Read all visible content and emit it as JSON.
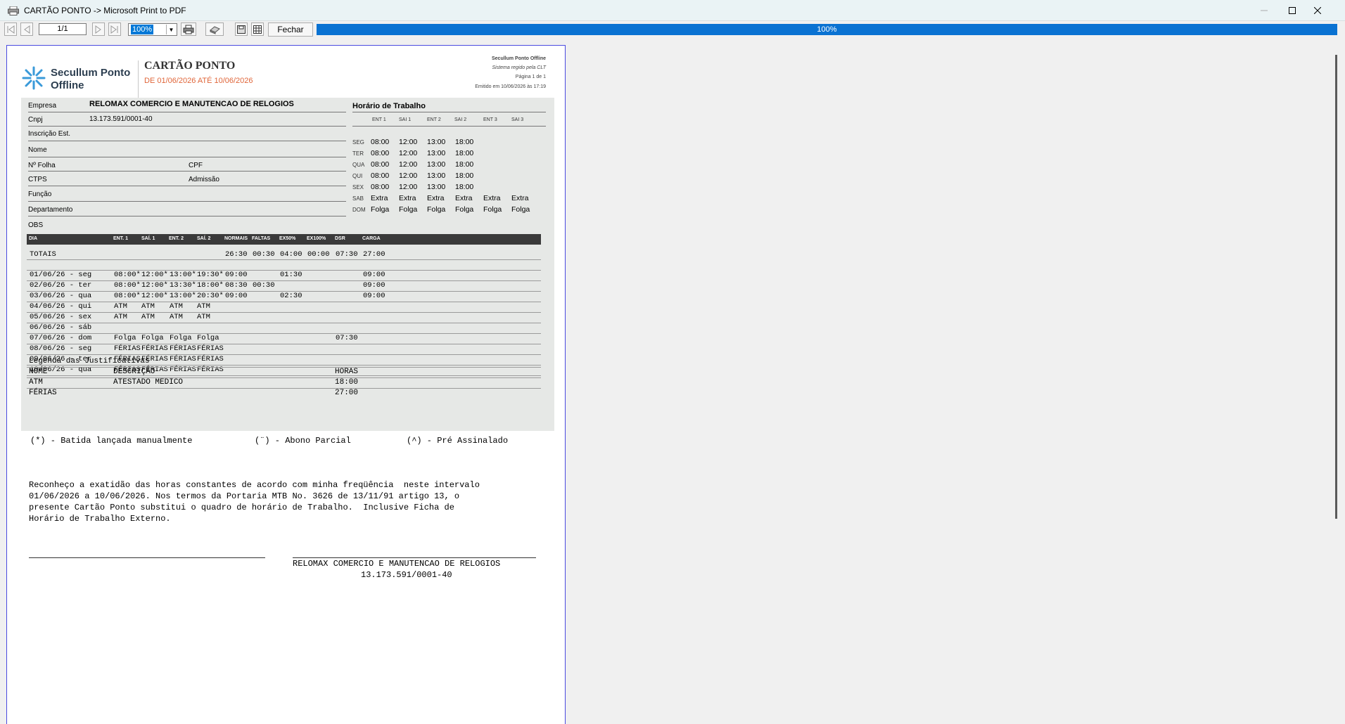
{
  "window": {
    "title": "CARTÃO PONTO -> Microsoft Print to PDF"
  },
  "toolbar": {
    "page": "1/1",
    "zoom": "100%",
    "close_label": "Fechar",
    "progress": "100%"
  },
  "header": {
    "brand_line1": "Secullum Ponto",
    "brand_line2": "Offline",
    "title": "CARTÃO PONTO",
    "period": "DE 01/06/2026 ATÉ 10/06/2026",
    "sys_name": "Secullum Ponto Offline",
    "sys_note": "Sistema regido pela CLT",
    "page_info": "Página 1 de 1",
    "issued": "Emitido em 10/06/2026 às 17:19"
  },
  "fields": {
    "empresa_label": "Empresa",
    "empresa_value": "RELOMAX COMERCIO E MANUTENCAO DE RELOGIOS",
    "cnpj_label": "Cnpj",
    "cnpj_value": "13.173.591/0001-40",
    "ie_label": "Inscrição Est.",
    "nome_label": "Nome",
    "folha_label": "Nº Folha",
    "cpf_label": "CPF",
    "ctps_label": "CTPS",
    "admissao_label": "Admissão",
    "funcao_label": "Função",
    "departamento_label": "Departamento",
    "obs_label": "OBS"
  },
  "horario": {
    "title": "Horário de Trabalho",
    "columns": [
      "ENT 1",
      "SAI 1",
      "ENT 2",
      "SAI 2",
      "ENT 3",
      "SAI 3"
    ],
    "rows": [
      {
        "day": "SEG",
        "times": [
          "08:00",
          "12:00",
          "13:00",
          "18:00",
          "",
          ""
        ]
      },
      {
        "day": "TER",
        "times": [
          "08:00",
          "12:00",
          "13:00",
          "18:00",
          "",
          ""
        ]
      },
      {
        "day": "QUA",
        "times": [
          "08:00",
          "12:00",
          "13:00",
          "18:00",
          "",
          ""
        ]
      },
      {
        "day": "QUI",
        "times": [
          "08:00",
          "12:00",
          "13:00",
          "18:00",
          "",
          ""
        ]
      },
      {
        "day": "SEX",
        "times": [
          "08:00",
          "12:00",
          "13:00",
          "18:00",
          "",
          ""
        ]
      },
      {
        "day": "SAB",
        "times": [
          "Extra",
          "Extra",
          "Extra",
          "Extra",
          "Extra",
          "Extra"
        ]
      },
      {
        "day": "DOM",
        "times": [
          "Folga",
          "Folga",
          "Folga",
          "Folga",
          "Folga",
          "Folga"
        ]
      }
    ]
  },
  "grid": {
    "headers": [
      "DIA",
      "ENT. 1",
      "SAÍ. 1",
      "ENT. 2",
      "SAÍ. 2",
      "NORMAIS",
      "FALTAS",
      "EX50%",
      "EX100%",
      "DSR",
      "CARGA"
    ],
    "totals": [
      "TOTAIS",
      "",
      "",
      "",
      "",
      "26:30",
      "00:30",
      "04:00",
      "00:00",
      "07:30",
      "27:00"
    ],
    "rows": [
      [
        "01/06/26 - seg",
        "08:00*",
        "12:00*",
        "13:00*",
        "19:30*",
        "09:00",
        "",
        "01:30",
        "",
        "",
        "09:00"
      ],
      [
        "02/06/26 - ter",
        "08:00*",
        "12:00*",
        "13:30*",
        "18:00*",
        "08:30",
        "00:30",
        "",
        "",
        "",
        "09:00"
      ],
      [
        "03/06/26 - qua",
        "08:00*",
        "12:00*",
        "13:00*",
        "20:30*",
        "09:00",
        "",
        "02:30",
        "",
        "",
        "09:00"
      ],
      [
        "04/06/26 - qui",
        "ATM",
        "ATM",
        "ATM",
        "ATM",
        "",
        "",
        "",
        "",
        "",
        ""
      ],
      [
        "05/06/26 - sex",
        "ATM",
        "ATM",
        "ATM",
        "ATM",
        "",
        "",
        "",
        "",
        "",
        ""
      ],
      [
        "06/06/26 - sáb",
        "",
        "",
        "",
        "",
        "",
        "",
        "",
        "",
        "",
        ""
      ],
      [
        "07/06/26 - dom",
        "Folga",
        "Folga",
        "Folga",
        "Folga",
        "",
        "",
        "",
        "",
        "07:30",
        ""
      ],
      [
        "08/06/26 - seg",
        "FÉRIAS",
        "FÉRIAS",
        "FÉRIAS",
        "FÉRIAS",
        "",
        "",
        "",
        "",
        "",
        ""
      ],
      [
        "09/06/26 - ter",
        "FÉRIAS",
        "FÉRIAS",
        "FÉRIAS",
        "FÉRIAS",
        "",
        "",
        "",
        "",
        "",
        ""
      ],
      [
        "10/06/26 - qua",
        "FÉRIAS",
        "FÉRIAS",
        "FÉRIAS",
        "FÉRIAS",
        "",
        "",
        "",
        "",
        "",
        ""
      ]
    ]
  },
  "legenda": {
    "title": "Legenda das Justificativas",
    "headers": [
      "NOME",
      "DESCRIÇÃO",
      "HORAS"
    ],
    "rows": [
      [
        "ATM",
        "ATESTADO MEDICO",
        "18:00"
      ],
      [
        "FÉRIAS",
        "",
        "27:00"
      ]
    ]
  },
  "footnotes": {
    "manual": "(*) - Batida lançada manualmente",
    "parcial": "(¨) - Abono Parcial",
    "pre": "(^) - Pré Assinalado"
  },
  "declaration": [
    "Reconheço a exatidão das horas constantes de acordo com minha freqüência  neste intervalo",
    "01/06/2026 a 10/06/2026. Nos termos da Portaria MTB No. 3626 de 13/11/91 artigo 13, o",
    "presente Cartão Ponto substitui o quadro de horário de Trabalho.  Inclusive Ficha de",
    "Horário de Trabalho Externo."
  ],
  "signature": {
    "company": "RELOMAX COMERCIO E MANUTENCAO DE RELOGIOS",
    "cnpj": "13.173.591/0001-40"
  }
}
